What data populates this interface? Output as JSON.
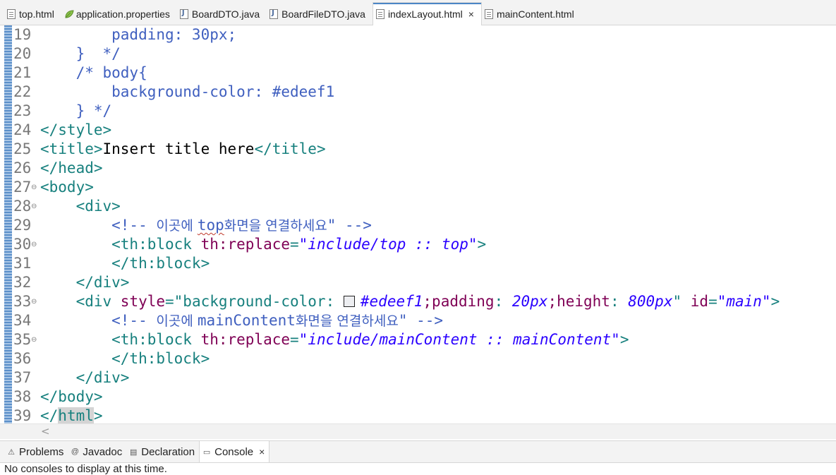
{
  "editor_tabs": [
    {
      "label": "top.html",
      "icon": "html-file-icon"
    },
    {
      "label": "application.properties",
      "icon": "properties-file-icon"
    },
    {
      "label": "BoardDTO.java",
      "icon": "java-file-icon"
    },
    {
      "label": "BoardFileDTO.java",
      "icon": "java-file-icon"
    },
    {
      "label": "indexLayout.html",
      "icon": "html-file-icon",
      "active": true,
      "close": "×"
    },
    {
      "label": "mainContent.html",
      "icon": "html-file-icon"
    }
  ],
  "code": {
    "lines": [
      {
        "n": "19",
        "fold": "",
        "parts": [
          [
            "css",
            "        padding: 30px;"
          ]
        ]
      },
      {
        "n": "20",
        "fold": "",
        "parts": [
          [
            "css",
            "    }  */"
          ]
        ]
      },
      {
        "n": "21",
        "fold": "",
        "parts": [
          [
            "css",
            "    /* body{"
          ]
        ]
      },
      {
        "n": "22",
        "fold": "",
        "parts": [
          [
            "css",
            "        background-color: #edeef1"
          ]
        ]
      },
      {
        "n": "23",
        "fold": "",
        "parts": [
          [
            "css",
            "    } */"
          ]
        ]
      },
      {
        "n": "24",
        "fold": "",
        "parts": [
          [
            "tag",
            "</style>"
          ]
        ]
      },
      {
        "n": "25",
        "fold": "",
        "parts": [
          [
            "tag",
            "<title>"
          ],
          [
            "txt",
            "Insert title here"
          ],
          [
            "tag",
            "</title>"
          ]
        ]
      },
      {
        "n": "26",
        "fold": "",
        "parts": [
          [
            "tag",
            "</head>"
          ]
        ]
      },
      {
        "n": "27",
        "fold": "⊖",
        "parts": [
          [
            "tag",
            "<body>"
          ]
        ]
      },
      {
        "n": "28",
        "fold": "⊖",
        "parts": [
          [
            "tag",
            "    <div>"
          ]
        ]
      },
      {
        "n": "29",
        "fold": "",
        "parts": [
          [
            "cmt",
            "        <!-- "
          ],
          [
            "cmtk",
            "이곳에 "
          ],
          [
            "cmtsq",
            "top"
          ],
          [
            "cmtk",
            "화면을 연결하세요"
          ],
          [
            "cmt",
            "\" -->"
          ]
        ]
      },
      {
        "n": "30",
        "fold": "⊖",
        "parts": [
          [
            "tag",
            "        <th:block "
          ],
          [
            "attr",
            "th:replace"
          ],
          [
            "tag",
            "="
          ],
          [
            "val",
            "\"include/top :: top\""
          ],
          [
            "tag",
            ">"
          ]
        ]
      },
      {
        "n": "31",
        "fold": "",
        "parts": [
          [
            "tag",
            "        </th:block>"
          ]
        ]
      },
      {
        "n": "32",
        "fold": "",
        "parts": [
          [
            "tag",
            "    </div>"
          ]
        ]
      },
      {
        "n": "33",
        "fold": "⊖",
        "parts": [
          [
            "tag",
            "    <div "
          ],
          [
            "attr",
            "style"
          ],
          [
            "tag",
            "=\"background-color: "
          ],
          [
            "swatch",
            ""
          ],
          [
            "val",
            "#edeef1"
          ],
          [
            "attr",
            ";padding"
          ],
          [
            "tag",
            ": "
          ],
          [
            "val",
            "20px"
          ],
          [
            "attr",
            ";height"
          ],
          [
            "tag",
            ": "
          ],
          [
            "val",
            "800px"
          ],
          [
            "tag",
            "\" "
          ],
          [
            "attr",
            "id"
          ],
          [
            "tag",
            "="
          ],
          [
            "val",
            "\"main\""
          ],
          [
            "tag",
            ">"
          ]
        ]
      },
      {
        "n": "34",
        "fold": "",
        "parts": [
          [
            "cmt",
            "        <!-- "
          ],
          [
            "cmtk",
            "이곳에 "
          ],
          [
            "cmt",
            "mainContent"
          ],
          [
            "cmtk",
            "화면을 연결하세요"
          ],
          [
            "cmt",
            "\" -->"
          ]
        ]
      },
      {
        "n": "35",
        "fold": "⊖",
        "parts": [
          [
            "tag",
            "        <th:block "
          ],
          [
            "attr",
            "th:replace"
          ],
          [
            "tag",
            "="
          ],
          [
            "val",
            "\"include/mainContent :: mainContent\""
          ],
          [
            "tag",
            ">"
          ]
        ]
      },
      {
        "n": "36",
        "fold": "",
        "parts": [
          [
            "tag",
            "        </th:block>"
          ]
        ]
      },
      {
        "n": "37",
        "fold": "",
        "parts": [
          [
            "tag",
            "    </div>"
          ]
        ]
      },
      {
        "n": "38",
        "fold": "",
        "parts": [
          [
            "tag",
            "</body>"
          ]
        ]
      },
      {
        "n": "39",
        "fold": "",
        "parts": [
          [
            "tag",
            "</"
          ],
          [
            "hl",
            "html"
          ],
          [
            "tag",
            ">"
          ]
        ]
      }
    ]
  },
  "scrollbar": {
    "left_arrow": "<"
  },
  "panel_tabs": [
    {
      "label": "Problems",
      "icon": "problems-icon",
      "glyph": "⚠"
    },
    {
      "label": "Javadoc",
      "icon": "javadoc-icon",
      "glyph": "@"
    },
    {
      "label": "Declaration",
      "icon": "declaration-icon",
      "glyph": "▤"
    },
    {
      "label": "Console",
      "icon": "console-icon",
      "glyph": "▭",
      "active": true,
      "close": "×"
    }
  ],
  "console": {
    "message": "No consoles to display at this time."
  },
  "colors": {
    "tab_accent": "#4c86c6",
    "tag": "#17807e",
    "attr": "#7f0055",
    "value": "#2a00ff",
    "comment": "#3f5fbf",
    "ruler": "#5b8fc9"
  }
}
